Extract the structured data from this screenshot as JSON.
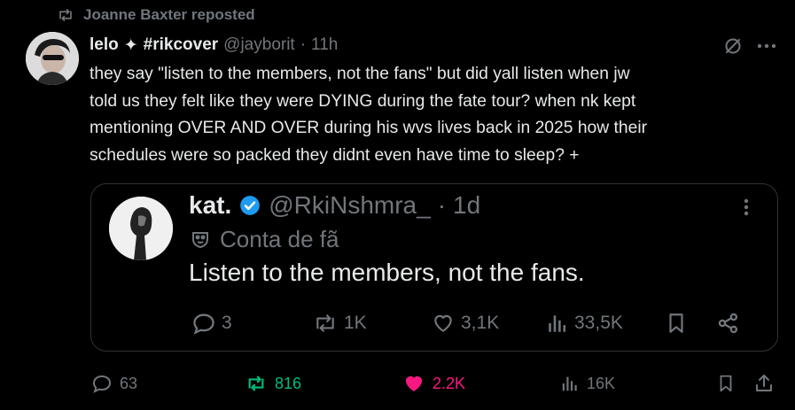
{
  "repost": {
    "text": "Joanne Baxter reposted",
    "icon": "repost-icon"
  },
  "tweet": {
    "name": "lelo",
    "sparkle": "✦",
    "name_suffix": "#rikcover",
    "handle": "@jayborit",
    "separator": "·",
    "time": "11h",
    "text": "they say \"listen to the members, not the fans\" but did yall listen when jw\ntold us they felt like they were DYING during the fate tour? when nk kept\nmentioning OVER AND OVER during his wvs lives back in 2025 how their\nschedules were so packed they didnt even have time to sleep? +"
  },
  "quote": {
    "name": "kat.",
    "handle": "@RkiNshmra_",
    "separator": "·",
    "time": "1d",
    "label": "Conta de fã",
    "text": "Listen to the members, not the fans.",
    "stats": {
      "replies": "3",
      "reposts": "1K",
      "likes": "3,1K",
      "views": "33,5K"
    }
  },
  "actions": {
    "replies": "63",
    "reposts": "816",
    "likes": "2.2K",
    "views": "16K"
  },
  "colors": {
    "background": "#000000",
    "text": "#e7e9ea",
    "muted": "#71767b",
    "repost_active": "#00ba7c",
    "like_active": "#f91880",
    "verified": "#1d9bf0",
    "border": "#2f3336"
  }
}
